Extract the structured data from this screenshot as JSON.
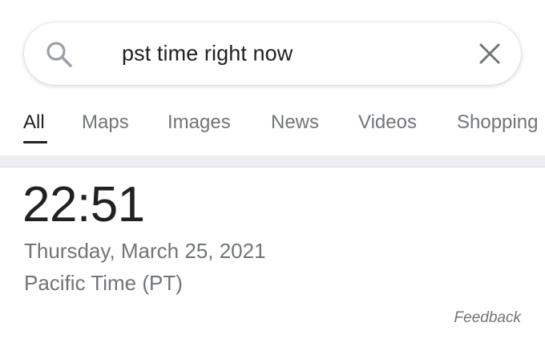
{
  "search": {
    "query": "pst time right now"
  },
  "tabs": [
    {
      "label": "All",
      "active": true
    },
    {
      "label": "Maps",
      "active": false
    },
    {
      "label": "Images",
      "active": false
    },
    {
      "label": "News",
      "active": false
    },
    {
      "label": "Videos",
      "active": false
    },
    {
      "label": "Shopping",
      "active": false
    }
  ],
  "result": {
    "time": "22:51",
    "date": "Thursday, March 25, 2021",
    "timezone": "Pacific Time (PT)"
  },
  "feedback_label": "Feedback",
  "colors": {
    "text_primary": "#202124",
    "text_secondary": "#70757a",
    "divider": "#eceef2"
  },
  "icons": {
    "search": "search-icon",
    "clear": "close-icon"
  }
}
